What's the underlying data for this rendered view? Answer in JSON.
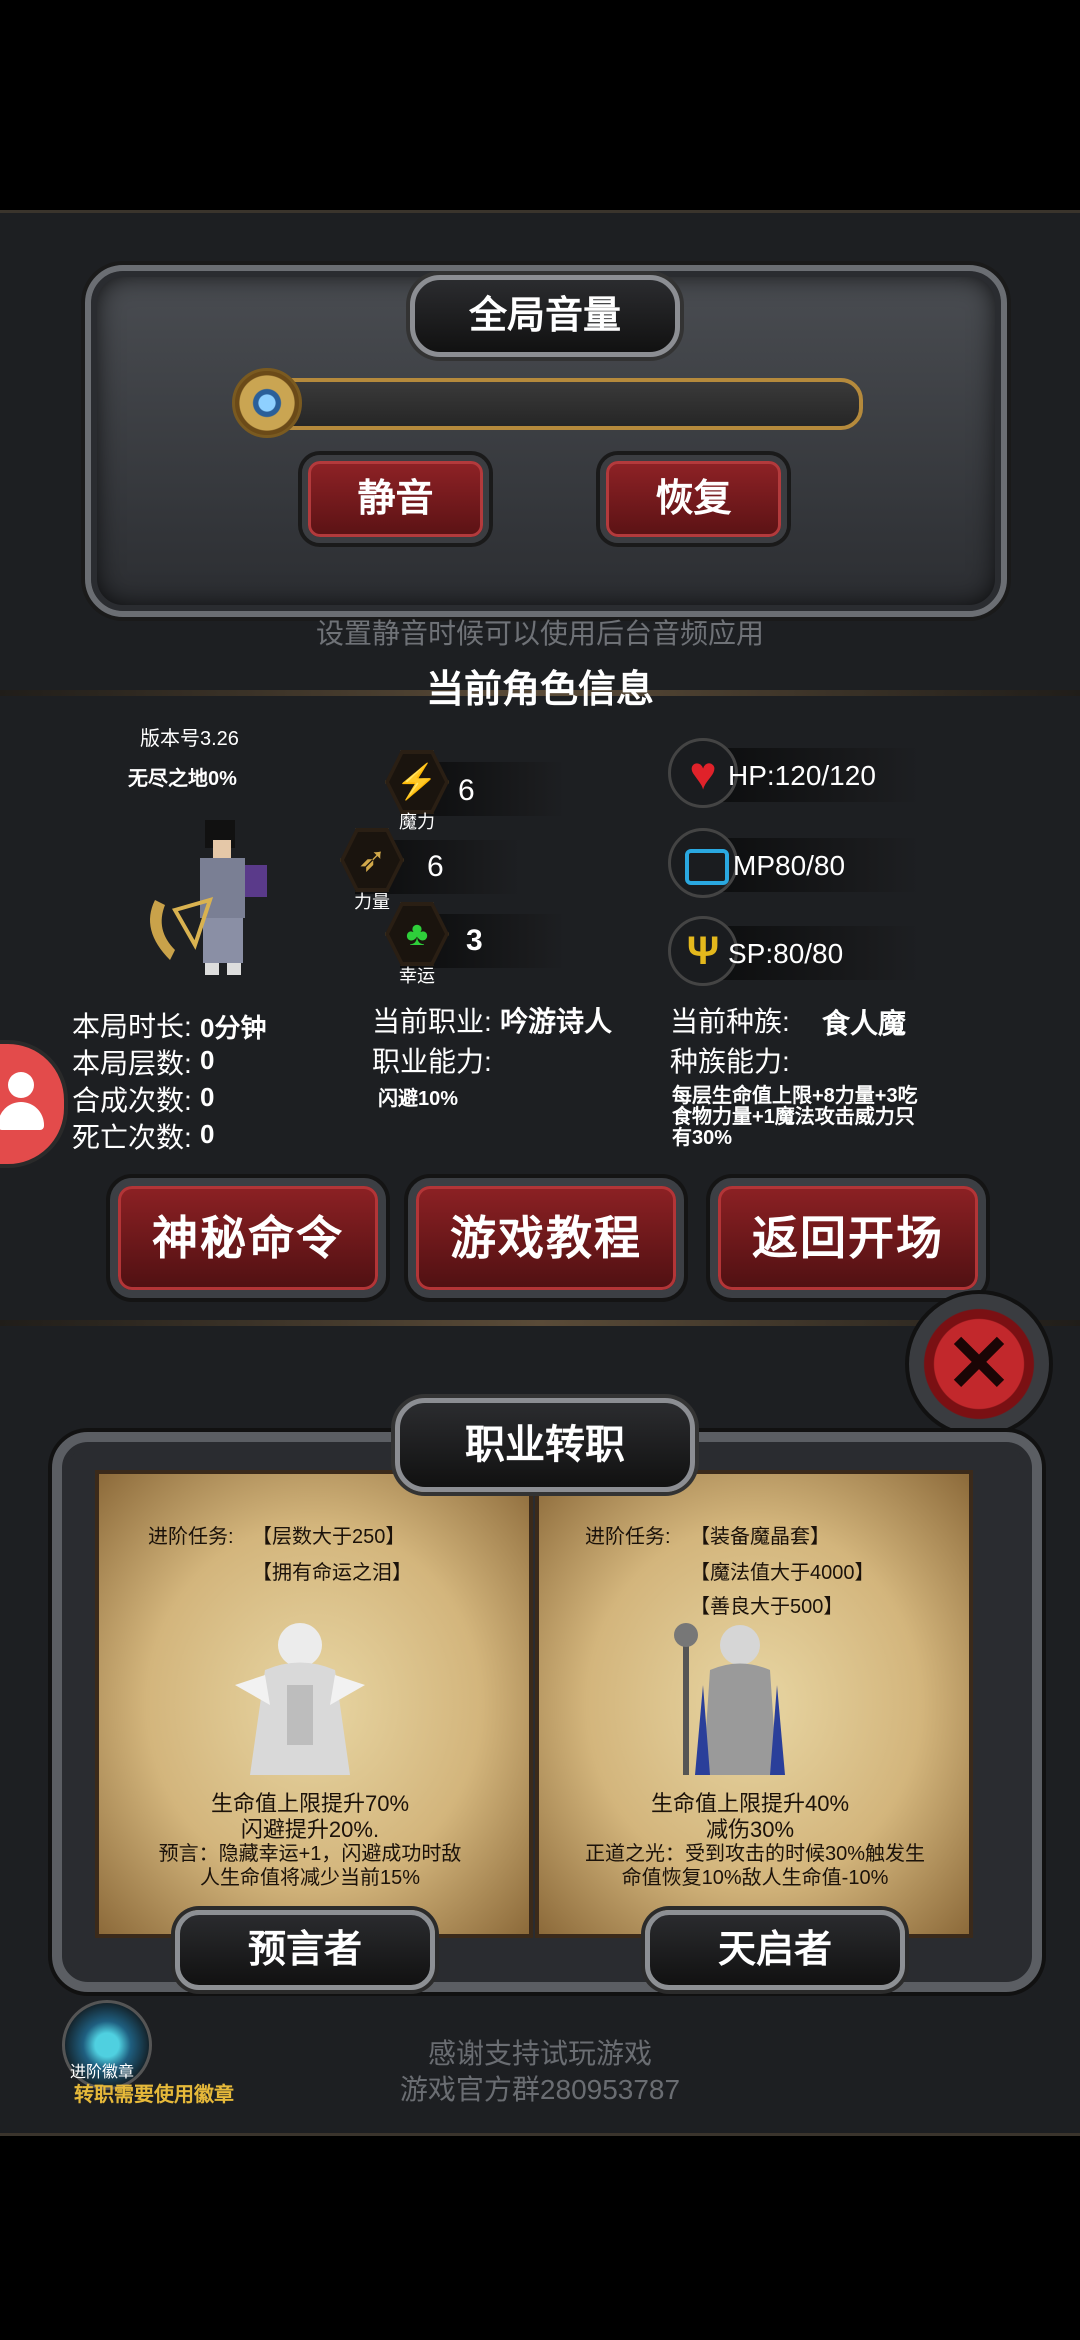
{
  "volume_panel": {
    "title": "全局音量",
    "mute_label": "静音",
    "restore_label": "恢复",
    "hint": "设置静音时候可以使用后台音频应用"
  },
  "character": {
    "section_title": "当前角色信息",
    "version": "版本号3.26",
    "endless": "无尽之地0%",
    "stats": [
      {
        "icon": "lightning-icon",
        "label": "魔力",
        "value": "6"
      },
      {
        "icon": "bow-icon",
        "label": "力量",
        "value": "6"
      },
      {
        "icon": "clover-icon",
        "label": "幸运",
        "value": "3"
      }
    ],
    "hp": "HP:120/120",
    "mp": "MP80/80",
    "sp": "SP:80/80",
    "play_time_label": "本局时长:",
    "play_time_value": "0分钟",
    "floors_label": "本局层数:",
    "floors_value": "0",
    "craft_label": "合成次数:",
    "craft_value": "0",
    "death_label": "死亡次数:",
    "death_value": "0",
    "job_label": "当前职业:",
    "job_value": "吟游诗人",
    "job_ability_label": "职业能力:",
    "job_ability_value": "闪避10%",
    "race_label": "当前种族:",
    "race_value": "食人魔",
    "race_ability_label": "种族能力:",
    "race_ability_value": "每层生命值上限+8力量+3吃食物力量+1魔法攻击威力只有30%"
  },
  "menu": {
    "secret_cmd": "神秘命令",
    "tutorial": "游戏教程",
    "back_to_start": "返回开场"
  },
  "job_change": {
    "title": "职业转职",
    "left": {
      "task_label": "进阶任务:",
      "task_1": "【层数大于250】",
      "task_2": "【拥有命运之泪】",
      "bonus_1": "生命值上限提升70%",
      "bonus_2": "闪避提升20%.",
      "desc": "预言：隐藏幸运+1，闪避成功时敌人生命值将减少当前15%",
      "name": "预言者"
    },
    "right": {
      "task_label": "进阶任务:",
      "task_1": "【装备魔晶套】",
      "task_2": "【魔法值大于4000】",
      "task_3": "【善良大于500】",
      "bonus_1": "生命值上限提升40%",
      "bonus_2": "减伤30%",
      "desc": "正道之光：受到攻击的时候30%触发生命值恢复10%敌人生命值-10%",
      "name": "天启者"
    }
  },
  "badge": {
    "label": "进阶徽章",
    "note": "转职需要使用徽章"
  },
  "footer": {
    "thanks": "感谢支持试玩游戏",
    "group": "游戏官方群280953787"
  }
}
